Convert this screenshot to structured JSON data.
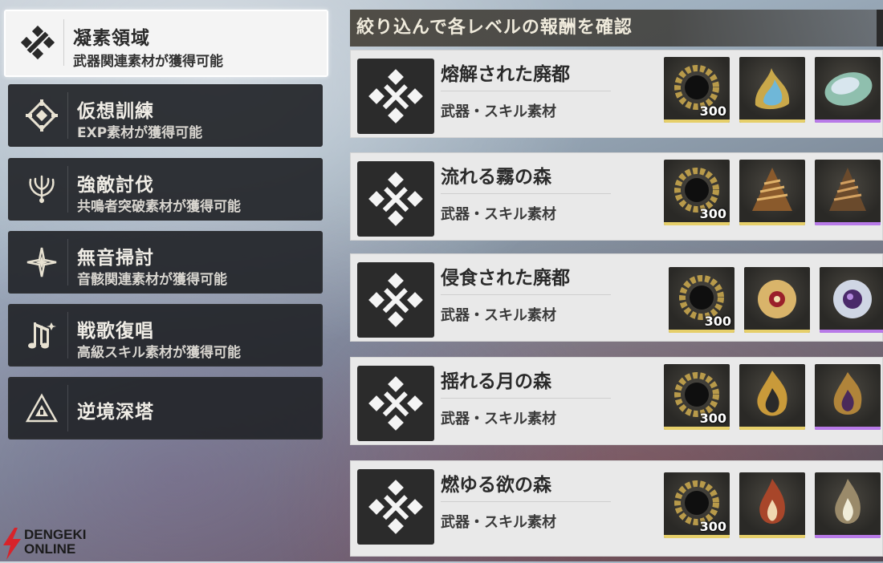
{
  "menu": {
    "items": [
      {
        "title": "凝素領域",
        "subtitle": "武器関連素材が獲得可能",
        "icon": "crystal-cross-icon",
        "active": true
      },
      {
        "title": "仮想訓練",
        "subtitle": "EXP素材が獲得可能",
        "icon": "diamond-core-icon"
      },
      {
        "title": "強敵討伐",
        "subtitle": "共鳴者突破素材が獲得可能",
        "icon": "crest-icon"
      },
      {
        "title": "無音掃討",
        "subtitle": "音骸関連素材が獲得可能",
        "icon": "sparkle-icon"
      },
      {
        "title": "戦歌復唱",
        "subtitle": "高級スキル素材が獲得可能",
        "icon": "music-note-icon"
      },
      {
        "title": "逆境深塔",
        "subtitle": "",
        "icon": "tower-triangle-icon"
      }
    ]
  },
  "header": {
    "title": "絞り込んで各レベルの報酬を確認"
  },
  "levels": [
    {
      "title": "熔解された廃都",
      "subtitle": "武器・スキル素材",
      "count": "300"
    },
    {
      "title": "流れる霧の森",
      "subtitle": "武器・スキル素材",
      "count": "300"
    },
    {
      "title": "侵食された廃都",
      "subtitle": "武器・スキル素材",
      "count": "300"
    },
    {
      "title": "揺れる月の森",
      "subtitle": "武器・スキル素材",
      "count": "300"
    },
    {
      "title": "燃ゆる欲の森",
      "subtitle": "武器・スキル素材",
      "count": "300"
    }
  ],
  "logo": {
    "line1": "DENGEKI",
    "line2": "ONLINE"
  },
  "colors": {
    "rarity_gold": "#e6cf6a",
    "rarity_purple": "#b87ae8",
    "accent_red": "#d8232a"
  }
}
